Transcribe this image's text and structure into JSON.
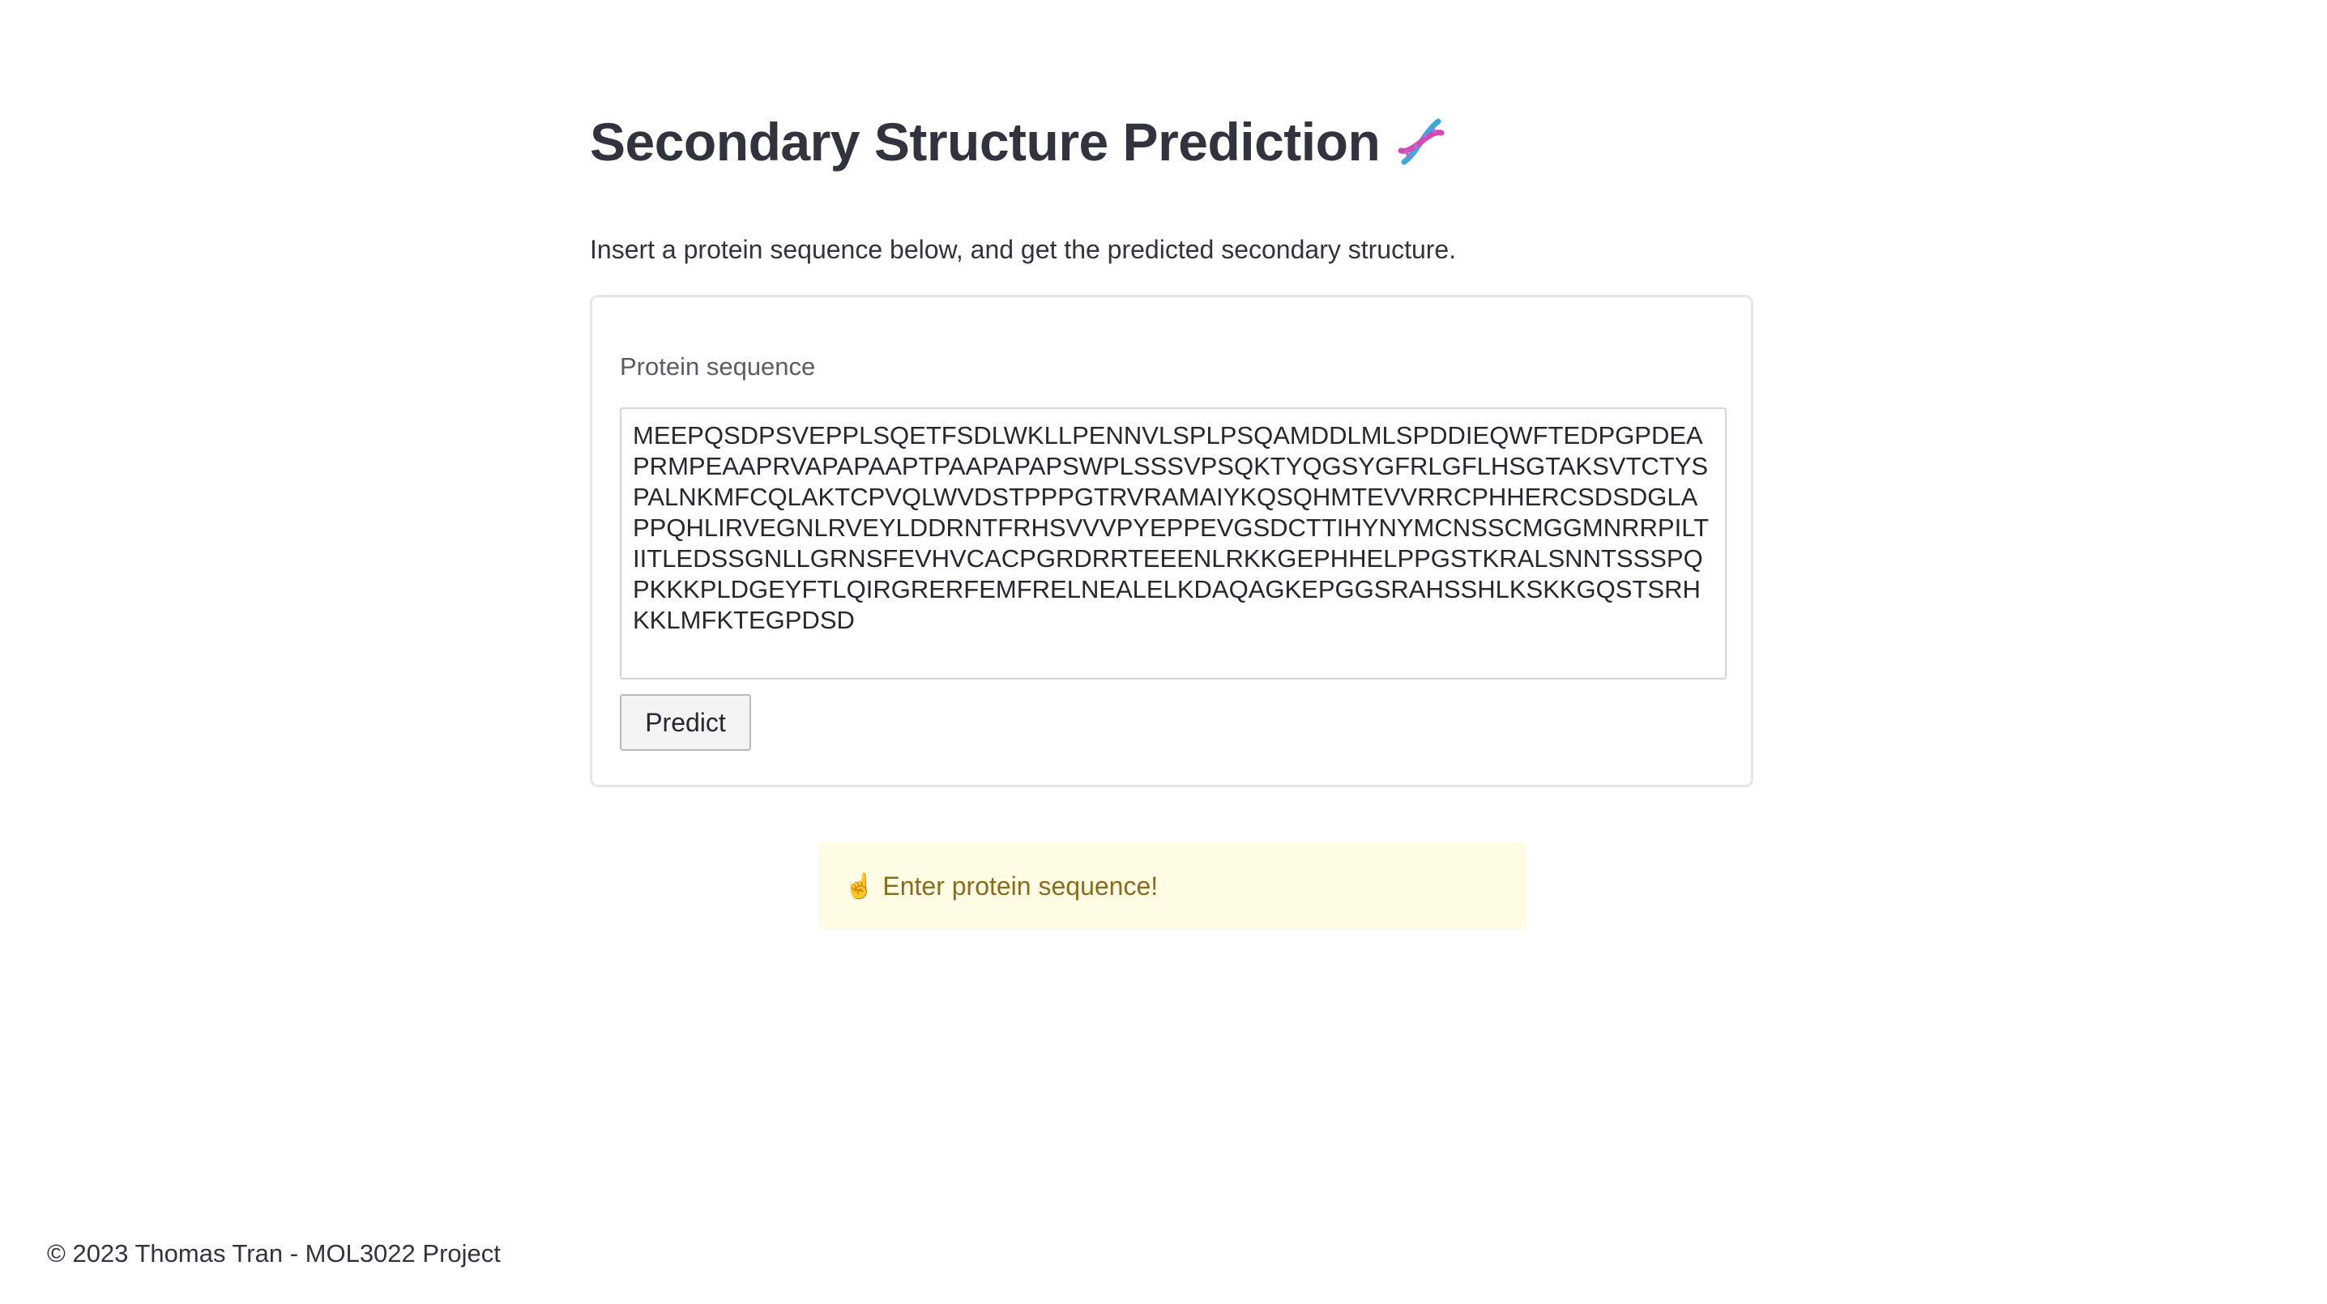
{
  "header": {
    "title": "Secondary Structure Prediction",
    "title_icon": "dna-icon"
  },
  "intro_text": "Insert a protein sequence below, and get the predicted secondary structure.",
  "form": {
    "label": "Protein sequence",
    "sequence": "MEEPQSDPSVEPPLSQETFSDLWKLLPENNVLSPLPSQAMDDLMLSPDDIEQWFTEDPGPDEAPRMPEAAPRVAPAPAAPTPAAPAPAPSWPLSSSVPSQKTYQGSYGFRLGFLHSGTAKSVTCTYSPALNKMFCQLAKTCPVQLWVDSTPPPGTRVRAMAIYKQSQHMTEVVRRCPHHERCSDSDGLAPPQHLIRVEGNLRVEYLDDRNTFRHSVVVPYEPPEVGSDCTTIHYNYMCNSSCMGGMNRRPILTIITLEDSSGNLLGRNSFEVHVCACPGRDRRTEEENLRKKGEPHHELPPGSTKRALSNNTSSSPQPKKKPLDGEYFTLQIRGRERFEMFRELNEALELKDAQAGKEPGGSRAHSSHLKSKKGQSTSRHKKLMFKTEGPDSD",
    "submit_label": "Predict"
  },
  "alert": {
    "icon": "☝️",
    "icon_name": "pointing-finger-icon",
    "text": "Enter protein sequence!",
    "background_color": "#fffce6",
    "text_color": "#8a6d1c"
  },
  "footer": {
    "text": "© 2023 Thomas Tran - MOL3022 Project"
  }
}
